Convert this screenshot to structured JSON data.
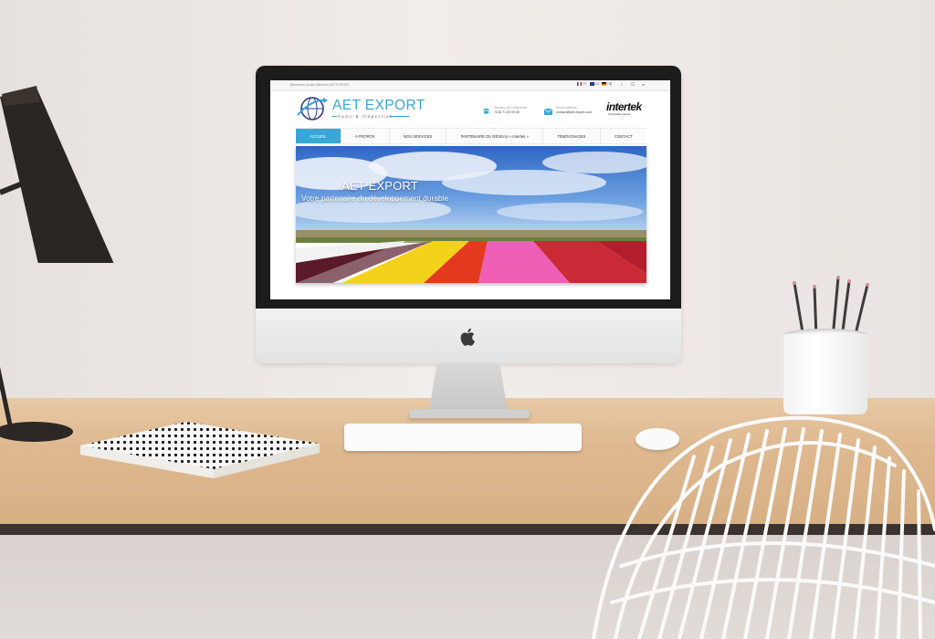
{
  "website": {
    "topbar": {
      "welcome": "Bienvenue au site officiel de AET EXPORT",
      "languages": [
        "FR",
        "EN",
        "DE"
      ],
      "social_icons": [
        "facebook-icon",
        "twitter-icon",
        "google-icon",
        "youtube-icon"
      ]
    },
    "header": {
      "brand": "AET EXPORT",
      "tagline": "Audit & Inspection",
      "phone_label": "Numéro de Téléphone",
      "phone_value": "+216 71 00 00 00",
      "email_label": "Email Address",
      "email_value": "contact@aet-export.com",
      "partner_logo": "intertek",
      "partner_tagline": "Total Quality Assured"
    },
    "nav": [
      "ACCUEIL",
      "A PROPOS",
      "NOS SERVICES",
      "PARTENAIRE DU RÉSEAU « Intertek »",
      "TÉMOIGNAGES",
      "CONTACT"
    ],
    "hero": {
      "title": "AET EXPORT",
      "subtitle": "Votre partenaire du développement durable"
    }
  },
  "colors": {
    "accent": "#3aa6d8",
    "nav_active_bg": "#3aa6d8",
    "brand_text": "#3aa6d8"
  }
}
